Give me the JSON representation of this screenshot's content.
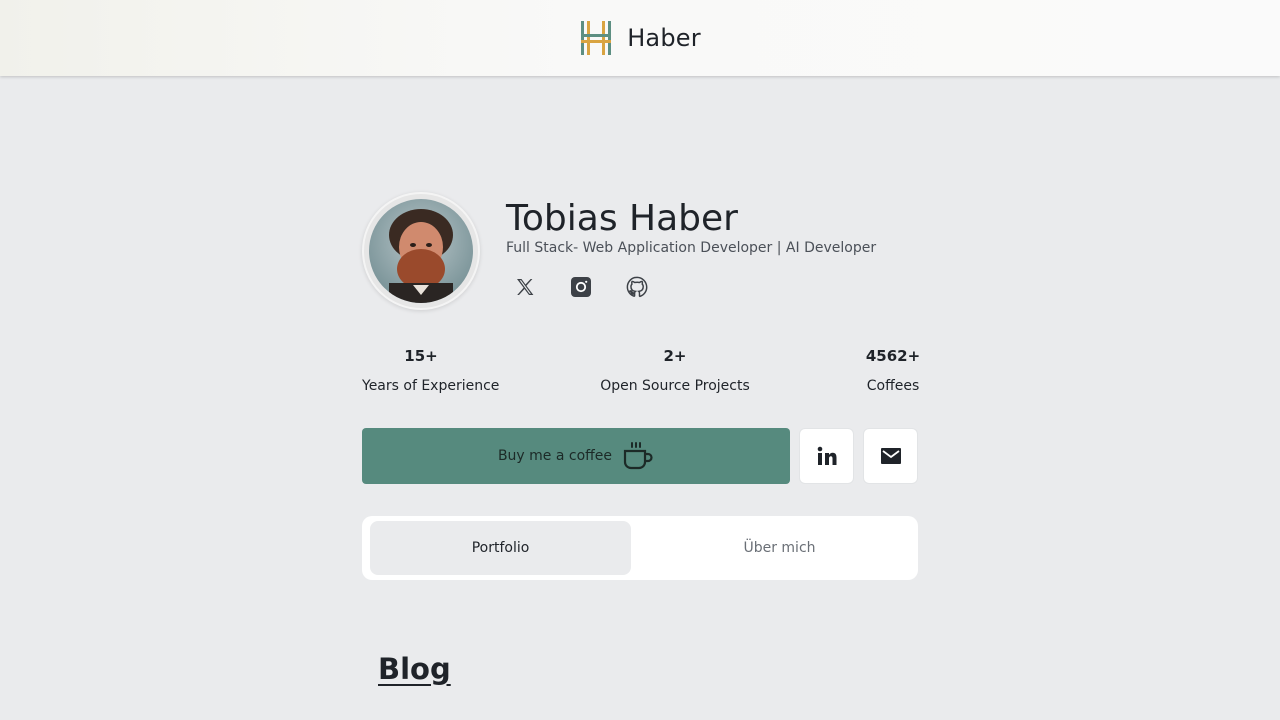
{
  "header": {
    "brand_name": "Haber",
    "logo_icon": "haber-h-logo-icon",
    "logo_colors": [
      "#5d8f82",
      "#d9a441"
    ]
  },
  "profile": {
    "name": "Tobias Haber",
    "tagline": "Full Stack- Web Application Developer | AI Developer",
    "avatar": "profile-photo",
    "socials": [
      {
        "name": "x-icon"
      },
      {
        "name": "instagram-icon"
      },
      {
        "name": "github-icon"
      }
    ]
  },
  "stats": [
    {
      "value": "15+",
      "label": "Years of Experience"
    },
    {
      "value": "2+",
      "label": "Open Source Projects"
    },
    {
      "value": "4562+",
      "label": "Coffees"
    }
  ],
  "actions": {
    "coffee_label": "Buy me a coffee",
    "coffee_icon": "coffee-cup-icon",
    "linkedin_icon": "linkedin-icon",
    "email_icon": "mail-icon",
    "accent_color": "#568a7e"
  },
  "tabs": [
    {
      "label": "Portfolio",
      "active": true
    },
    {
      "label": "Über mich",
      "active": false
    }
  ],
  "blog": {
    "title": "Blog"
  }
}
